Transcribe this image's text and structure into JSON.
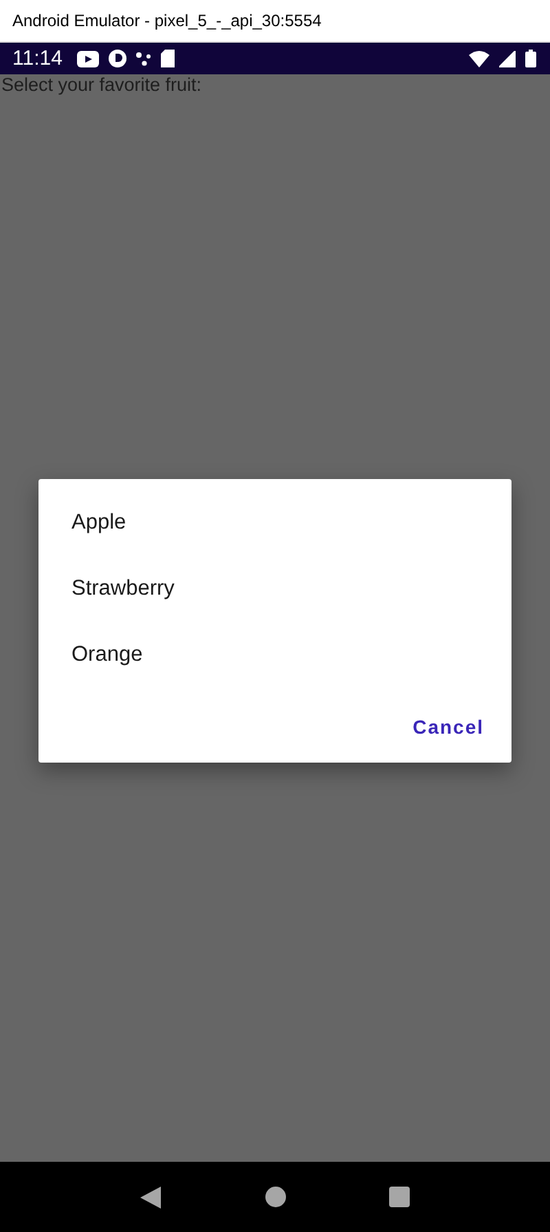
{
  "window": {
    "title": "Android Emulator - pixel_5_-_api_30:5554"
  },
  "status_bar": {
    "time": "11:14"
  },
  "page": {
    "prompt": "Select your favorite fruit:"
  },
  "dialog": {
    "options": [
      "Apple",
      "Strawberry",
      "Orange"
    ],
    "cancel": "Cancel"
  }
}
